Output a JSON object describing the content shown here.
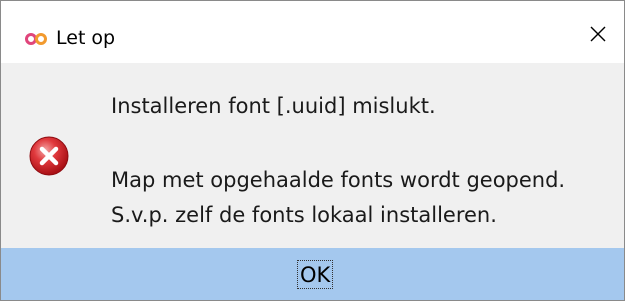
{
  "window": {
    "title": "Let op",
    "app_icon": "infinity-logo-icon",
    "close_icon": "close-icon"
  },
  "message": {
    "line1": "Installeren font [.uuid] mislukt.",
    "line2": "Map met opgehaalde fonts wordt geopend.",
    "line3": "S.v.p. zelf de fonts lokaal installeren.",
    "icon": "error-icon"
  },
  "buttons": {
    "ok_label": "OK"
  },
  "colors": {
    "footer": "#a4c8ee",
    "content_bg": "#f0f0f0",
    "error_red": "#d9262b",
    "logo_left": "#e0457b",
    "logo_right": "#f29a2e"
  }
}
